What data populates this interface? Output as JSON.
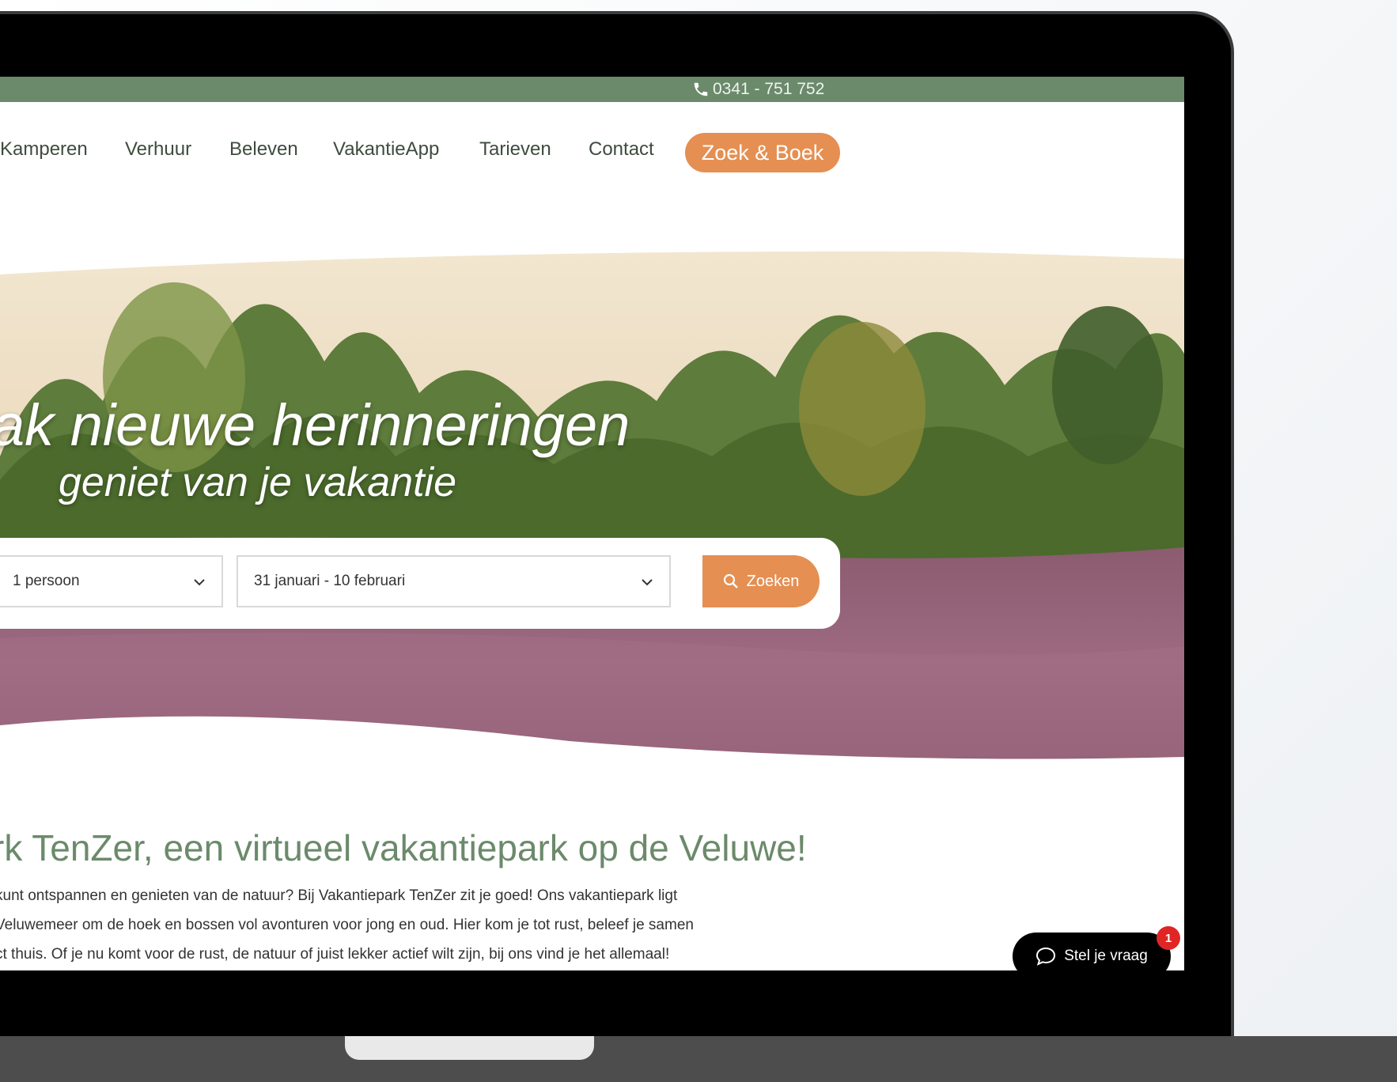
{
  "topbar": {
    "phone": "0341 - 751 752",
    "phone_icon": "phone-icon"
  },
  "nav": {
    "items": [
      "Kamperen",
      "Verhuur",
      "Beleven",
      "VakantieApp",
      "Tarieven",
      "Contact"
    ],
    "cta": "Zoek & Boek"
  },
  "hero": {
    "headline": "ak nieuwe herinneringen",
    "subline": "geniet van je vakantie"
  },
  "search": {
    "persons_value": "1 persoon",
    "dates_value": "31 januari - 10 februari",
    "button_label": "Zoeken",
    "button_icon": "search-icon"
  },
  "intro": {
    "title": "rk TenZer, een virtueel vakantiepark op de Veluwe!",
    "lines": [
      "kunt ontspannen en genieten van de natuur? Bij Vakantiepark TenZer zit je goed! Ons vakantiepark ligt",
      "Veluwemeer om de hoek en bossen vol avonturen voor jong en oud. Hier kom je tot rust, beleef je samen",
      "ct thuis. Of je nu komt voor de rust, de natuur of juist lekker actief wilt zijn, bij ons vind je het allemaal!"
    ]
  },
  "chat": {
    "label": "Stel je vraag",
    "badge": "1",
    "icon": "chat-bubble-icon"
  },
  "colors": {
    "green": "#6b8a6b",
    "orange": "#e58f52",
    "bezel": "#000000"
  }
}
